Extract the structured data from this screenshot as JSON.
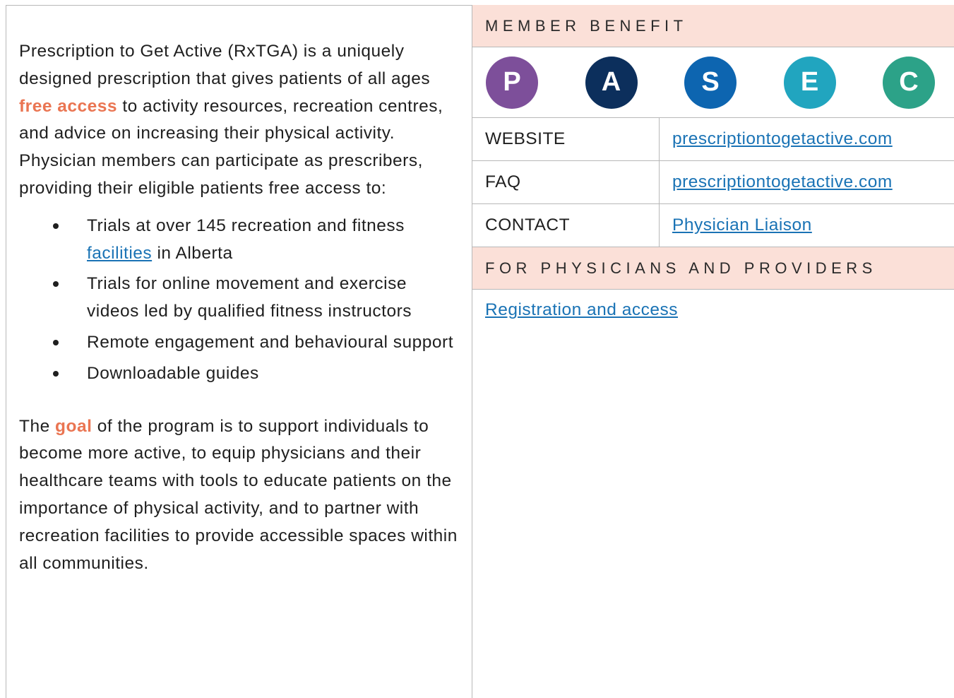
{
  "left": {
    "intro_before": "Prescription to Get Active (RxTGA) is a uniquely designed prescription that gives patients of all ages ",
    "intro_highlight": "free access",
    "intro_after": " to activity resources, recreation centres, and advice on increasing their physical activity. Physician members can participate as prescribers, providing their eligible patients free access to:",
    "bullets": [
      {
        "before": "Trials at over 145 recreation and fitness ",
        "link": "facilities",
        "after": " in Alberta"
      },
      {
        "text": "Trials for online movement and exercise videos led by qualified fitness instructors"
      },
      {
        "text": "Remote engagement and behavioural support"
      },
      {
        "text": "Downloadable guides"
      }
    ],
    "goal_before": "The ",
    "goal_highlight": "goal",
    "goal_after": " of the program is to support individuals to become more active, to equip physicians and their healthcare teams with tools to educate patients on the importance of physical activity, and to partner with recreation facilities to provide accessible spaces within all communities."
  },
  "right": {
    "member_benefit_heading": "MEMBER BENEFIT",
    "pasec": [
      {
        "letter": "P",
        "color": "#7d4f9a"
      },
      {
        "letter": "A",
        "color": "#0c2f5c"
      },
      {
        "letter": "S",
        "color": "#0d65b0"
      },
      {
        "letter": "E",
        "color": "#21a5bf"
      },
      {
        "letter": "C",
        "color": "#2ca288"
      }
    ],
    "rows": [
      {
        "label": "WEBSITE",
        "value": "prescriptiontogetactive.com"
      },
      {
        "label": "FAQ",
        "value": "prescriptiontogetactive.com"
      },
      {
        "label": "CONTACT",
        "value": "Physician Liaison"
      }
    ],
    "physicians_heading": "FOR PHYSICIANS AND PROVIDERS",
    "registration_link": "Registration and access"
  },
  "colors": {
    "highlight": "#ea7552",
    "link": "#1a73b5",
    "band": "#fbe0d8"
  }
}
